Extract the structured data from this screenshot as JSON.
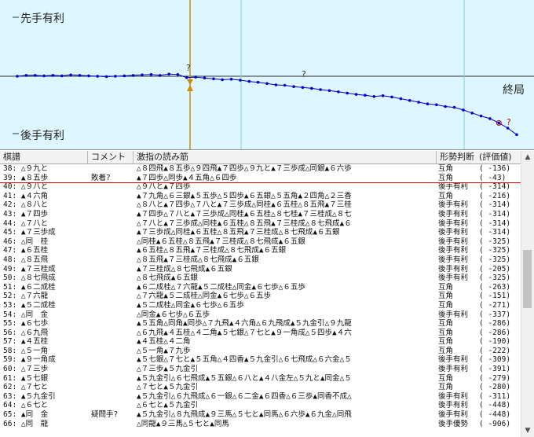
{
  "graph": {
    "label_sente": "先手有利",
    "label_gote": "後手有利",
    "label_end": "終局",
    "marker_text": "?",
    "colors": {
      "background": "#ddf6ff",
      "line": "#0000cc",
      "cursor": "#d08c00",
      "marker": "#b00000"
    },
    "evaluations": [
      0,
      2,
      2,
      1,
      2,
      1,
      3,
      2,
      1,
      0,
      -1,
      0,
      1,
      2,
      3,
      4,
      2,
      5,
      4,
      -3,
      -2,
      -4,
      -6,
      -8,
      -7,
      -9,
      -12,
      -14,
      -17,
      -20,
      -21,
      -24,
      -26,
      -28,
      -31,
      -33,
      -36,
      -39,
      -42,
      -44,
      -47,
      -45,
      -48,
      -52,
      -56,
      -60,
      -64,
      -66,
      -70,
      -72,
      -78,
      -85,
      -92,
      -98,
      -108,
      -120,
      -135
    ]
  },
  "kifu": {
    "columns": [
      "棋譜",
      "コメント",
      "激指の読み筋",
      "形勢判断",
      "(評価値)"
    ],
    "rows": [
      {
        "move": "38: △９九と",
        "comment": "",
        "pv": "△８四飛▲８五歩△９四飛▲７四歩△９九と▲７三歩成△同銀▲６六歩",
        "judge": "互角",
        "value": "( -136)"
      },
      {
        "move": "39: ▲８五歩",
        "comment": "敗着?",
        "pv": "▲７四歩△同歩▲４五角△６四歩",
        "judge": "互角",
        "value": "(  -43)"
      },
      {
        "move": "40: △９八と",
        "comment": "",
        "pv": "△９八と▲７四歩",
        "judge": "後手有利",
        "value": "( -314)"
      },
      {
        "move": "41: ▲４六角",
        "comment": "",
        "pv": "▲７九角△６三銀▲５五歩△５四歩▲６五銀△５五角▲２四角△２三香",
        "judge": "互角",
        "value": "( -216)"
      },
      {
        "move": "42: △８八と",
        "comment": "",
        "pv": "△８八と▲７四歩△７八と▲７三歩成△同桂▲６五桂△８五飛▲７三桂",
        "judge": "後手有利",
        "value": "( -314)"
      },
      {
        "move": "43: ▲７四歩",
        "comment": "",
        "pv": "▲７四歩△７八と▲７三歩成△同桂▲６五桂△８七桂▲７三桂成△８七",
        "judge": "後手有利",
        "value": "( -314)"
      },
      {
        "move": "44: △７八と",
        "comment": "",
        "pv": "△７八と▲７三歩成△同桂▲６五桂△８五飛▲７三桂成△８七飛成▲６",
        "judge": "後手有利",
        "value": "( -314)"
      },
      {
        "move": "45: ▲７三歩成",
        "comment": "",
        "pv": "▲７三歩成△同桂▲６五桂△８五飛▲７三桂成△８七飛成▲６五銀",
        "judge": "後手有利",
        "value": "( -314)"
      },
      {
        "move": "46: △同　桂",
        "comment": "",
        "pv": "△同桂▲６五桂△８五飛▲７三桂成△８七飛成▲６五銀",
        "judge": "後手有利",
        "value": "( -325)"
      },
      {
        "move": "47: ▲６五桂",
        "comment": "",
        "pv": "▲６五桂△８五飛▲７三桂成△８七飛成▲６五銀",
        "judge": "後手有利",
        "value": "( -325)"
      },
      {
        "move": "48: △８五飛",
        "comment": "",
        "pv": "△８五飛▲７三桂成△８七飛成▲６五銀",
        "judge": "後手有利",
        "value": "( -325)"
      },
      {
        "move": "49: ▲７三桂成",
        "comment": "",
        "pv": "▲７三桂成△８七飛成▲６五銀",
        "judge": "後手有利",
        "value": "( -205)"
      },
      {
        "move": "50: △８七飛成",
        "comment": "",
        "pv": "△８七飛成▲６五銀",
        "judge": "後手有利",
        "value": "( -325)"
      },
      {
        "move": "51: ▲６二成桂",
        "comment": "",
        "pv": "▲６二成桂△７六龍▲５二成桂△同金▲６七歩△６五歩",
        "judge": "互角",
        "value": "( -263)"
      },
      {
        "move": "52: △７六龍",
        "comment": "",
        "pv": "△７六龍▲５二成桂△同金▲６七歩△６五歩",
        "judge": "互角",
        "value": "( -151)"
      },
      {
        "move": "53: ▲５二成桂",
        "comment": "",
        "pv": "▲５二成桂△同金▲６七歩△６五歩",
        "judge": "互角",
        "value": "( -271)"
      },
      {
        "move": "54: △同　金",
        "comment": "",
        "pv": "△同金▲６七歩△６五歩",
        "judge": "後手有利",
        "value": "( -337)"
      },
      {
        "move": "55: ▲６七歩",
        "comment": "",
        "pv": "▲５五角△同角▲同歩△７九飛▲４六角△６九飛成▲５九金引△９九龍",
        "judge": "互角",
        "value": "( -286)"
      },
      {
        "move": "56: △６九飛",
        "comment": "",
        "pv": "△６九飛▲４五桂△４二角▲５七銀△７七と▲９一角成△５四歩▲４六",
        "judge": "互角",
        "value": "( -286)"
      },
      {
        "move": "57: ▲４五桂",
        "comment": "",
        "pv": "▲４五桂△４二角",
        "judge": "互角",
        "value": "( -190)"
      },
      {
        "move": "58: △５一角",
        "comment": "",
        "pv": "△５一角▲７九歩",
        "judge": "互角",
        "value": "( -222)"
      },
      {
        "move": "59: ▲９一角成",
        "comment": "",
        "pv": "▲５七銀△７七と▲５五角△４四香▲５九金引△６七飛成△６六金△５",
        "judge": "後手有利",
        "value": "( -309)"
      },
      {
        "move": "60: △７三歩",
        "comment": "",
        "pv": "△７三歩▲５九金引",
        "judge": "後手有利",
        "value": "( -391)"
      },
      {
        "move": "61: ▲５七銀",
        "comment": "",
        "pv": "▲５九金引△６七飛成▲５五銀△６八と▲４八金左△５九と▲同金△５",
        "judge": "互角",
        "value": "( -279)"
      },
      {
        "move": "62: △７七と",
        "comment": "",
        "pv": "△７七と▲５九金引",
        "judge": "互角",
        "value": "( -280)"
      },
      {
        "move": "63: ▲５九金引",
        "comment": "",
        "pv": "▲５九金引△６九飛成△６一銀△６二金▲６四香△６三歩▲同香不成△",
        "judge": "後手有利",
        "value": "( -311)"
      },
      {
        "move": "64: △６七と",
        "comment": "",
        "pv": "△６七と▲５九金引",
        "judge": "後手有利",
        "value": "( -448)"
      },
      {
        "move": "65: ▲同　金",
        "comment": "疑問手?",
        "pv": "▲５九金引△８九飛成▲９三馬△５七と▲同馬△６六歩▲６九金△同飛",
        "judge": "後手有利",
        "value": "( -448)"
      },
      {
        "move": "66: △同　龍",
        "comment": "",
        "pv": "△同龍▲９三馬△５七と▲同馬",
        "judge": "後手優勢",
        "value": "( -906)"
      }
    ]
  },
  "scrollbar": {
    "up_icon": "▲",
    "down_icon": "▼"
  }
}
